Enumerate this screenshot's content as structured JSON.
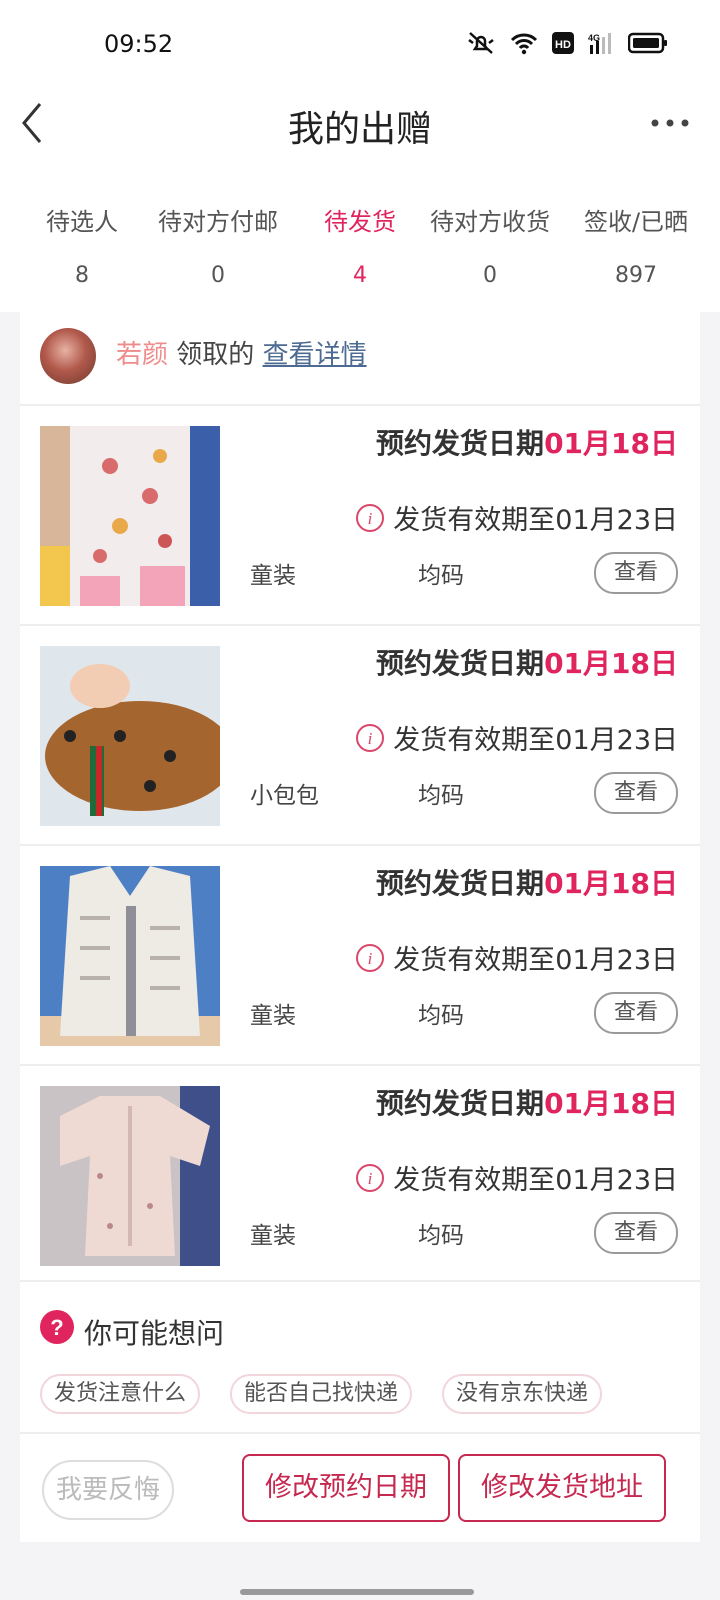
{
  "status_bar": {
    "time": "09:52"
  },
  "header": {
    "title": "我的出赠"
  },
  "tabs": [
    {
      "label": "待选人",
      "count": "8"
    },
    {
      "label": "待对方付邮",
      "count": "0"
    },
    {
      "label": "待发货",
      "count": "4"
    },
    {
      "label": "待对方收货",
      "count": "0"
    },
    {
      "label": "签收/已晒",
      "count": "897"
    }
  ],
  "active_tab": "待发货",
  "owner": {
    "name": "若颜",
    "claimed_text": "领取的",
    "details_link": "查看详情"
  },
  "items": [
    {
      "schedule_label": "预约发货日期",
      "schedule_date": "01月18日",
      "valid_text": "发货有效期至01月23日",
      "category": "童装",
      "size": "均码",
      "view_label": "查看"
    },
    {
      "schedule_label": "预约发货日期",
      "schedule_date": "01月18日",
      "valid_text": "发货有效期至01月23日",
      "category": "小包包",
      "size": "均码",
      "view_label": "查看"
    },
    {
      "schedule_label": "预约发货日期",
      "schedule_date": "01月18日",
      "valid_text": "发货有效期至01月23日",
      "category": "童装",
      "size": "均码",
      "view_label": "查看"
    },
    {
      "schedule_label": "预约发货日期",
      "schedule_date": "01月18日",
      "valid_text": "发货有效期至01月23日",
      "category": "童装",
      "size": "均码",
      "view_label": "查看"
    }
  ],
  "faq": {
    "title": "你可能想问",
    "chips": [
      "发货注意什么",
      "能否自己找快递",
      "没有京东快递"
    ]
  },
  "actions": {
    "regret": "我要反悔",
    "change_date": "修改预约日期",
    "change_address": "修改发货地址"
  },
  "colors": {
    "accent": "#e0245e",
    "button_border": "#c62850"
  }
}
